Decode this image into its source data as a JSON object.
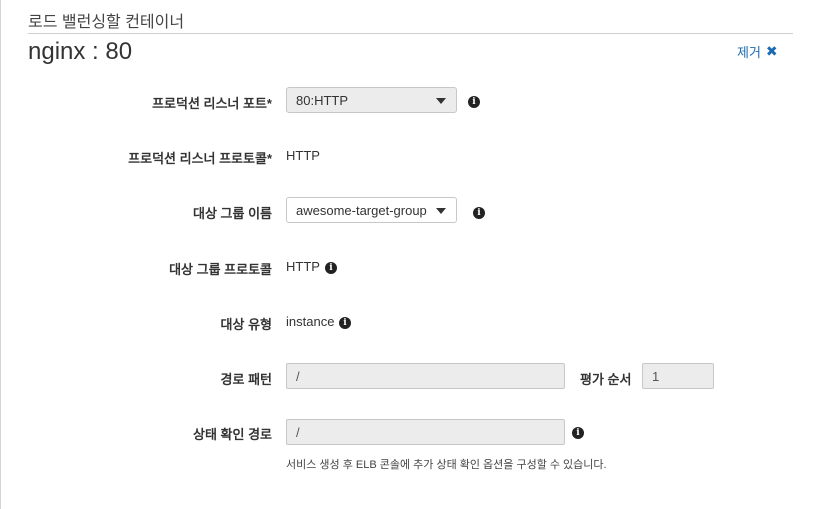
{
  "section": {
    "title": "로드 밸런싱할 컨테이너"
  },
  "container": {
    "title": "nginx : 80",
    "remove_label": "제거",
    "remove_icon": "close-icon"
  },
  "form": {
    "listener_port": {
      "label": "프로덕션 리스너 포트*",
      "value": "80:HTTP"
    },
    "listener_protocol": {
      "label": "프로덕션 리스너 프로토콜*",
      "value": "HTTP"
    },
    "target_group_name": {
      "label": "대상 그룹 이름",
      "value": "awesome-target-group"
    },
    "target_group_protocol": {
      "label": "대상 그룹 프로토콜",
      "value": "HTTP"
    },
    "target_type": {
      "label": "대상 유형",
      "value": "instance"
    },
    "path_pattern": {
      "label": "경로 패턴",
      "value": "/"
    },
    "evaluation_order": {
      "label": "평가 순서",
      "value": "1"
    },
    "health_check_path": {
      "label": "상태 확인 경로",
      "value": "/",
      "help": "서비스 생성 후 ELB 콘솔에 추가 상태 확인 옵션을 구성할 수 있습니다."
    }
  },
  "colors": {
    "link": "#1b6bb3",
    "disabled_bg": "#ececec"
  },
  "icons": {
    "info": "info-icon",
    "dropdown": "chevron-down-icon"
  }
}
